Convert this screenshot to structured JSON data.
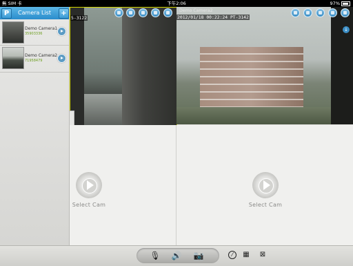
{
  "status_bar": {
    "carrier": "無 SIM 卡",
    "time": "下午2:06",
    "battery": "97%"
  },
  "sidebar": {
    "title": "Camera List",
    "left_button_icon": "p-icon",
    "add_button_label": "+",
    "cameras": [
      {
        "name": "Demo Camera1",
        "id": "35903336"
      },
      {
        "name": "Demo Camera2",
        "id": "71958479"
      }
    ]
  },
  "view1": {
    "osd_text": "5-3122"
  },
  "view2": {
    "camera_name": "Demo Camera2",
    "osd_text": "2012/01/18 00:22:24 PT-3142"
  },
  "toolbar_icons": [
    "stop-icon",
    "download-icon",
    "speaker-icon",
    "record-icon",
    "settings-icon"
  ],
  "lower_panes": [
    {
      "label": "Select Cam"
    },
    {
      "label": "Select Cam"
    }
  ],
  "bottom_bar": {
    "pill_icons": [
      "microphone-icon",
      "speaker-icon",
      "camera-icon"
    ],
    "right_icons": [
      "compass-icon",
      "grid-icon",
      "fullscreen-icon"
    ]
  },
  "colors": {
    "accent": "#2a8dcc",
    "camera_id_green": "#6d9e1f",
    "selected_border": "#d6d800"
  }
}
